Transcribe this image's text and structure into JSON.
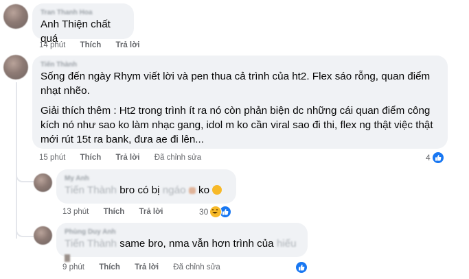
{
  "comments": [
    {
      "author": "Tran Thanh Hoa",
      "text": "Anh Thiện chất quá",
      "time": "14 phút",
      "like": "Thích",
      "reply": "Trả lời"
    },
    {
      "author": "Tiến Thành",
      "paragraph1": "Sống đến ngày Rhym viết lời và pen thua cả trình của ht2. Flex sáo rỗng, quan điểm nhạt nhẽo.",
      "paragraph2": "Giải thích thêm : Ht2 trong trình ít ra nó còn phản biện dc những cái quan điểm công kích nó như sao ko làm nhạc gang, idol m ko cần viral sao đi thi, flex ng thật việc thật mới rút 15t ra bank, đưa ae đi lên...",
      "time": "15 phút",
      "like": "Thích",
      "reply": "Trả lời",
      "edited": "Đã chỉnh sửa",
      "reaction_count": "4"
    }
  ],
  "replies": [
    {
      "author": "My Anh",
      "mention": "Tiến Thành",
      "text_a": "bro có bị",
      "hidden": "ngáo",
      "text_b": "ko",
      "time": "13 phút",
      "like": "Thích",
      "reply": "Trả lời",
      "reaction_count": "30"
    },
    {
      "author": "Phùng Duy Anh",
      "mention": "Tiến Thành",
      "text_a": "same bro, nma vẫn hơn trình của",
      "hidden": "hiếu",
      "time": "9 phút",
      "like": "Thích",
      "reply": "Trả lời",
      "edited": "Đã chỉnh sửa"
    }
  ],
  "colors": {
    "bubble": "#f0f2f5",
    "meta": "#65676b",
    "like_blue": "#1877f2",
    "haha_yellow": "#f7b928"
  }
}
